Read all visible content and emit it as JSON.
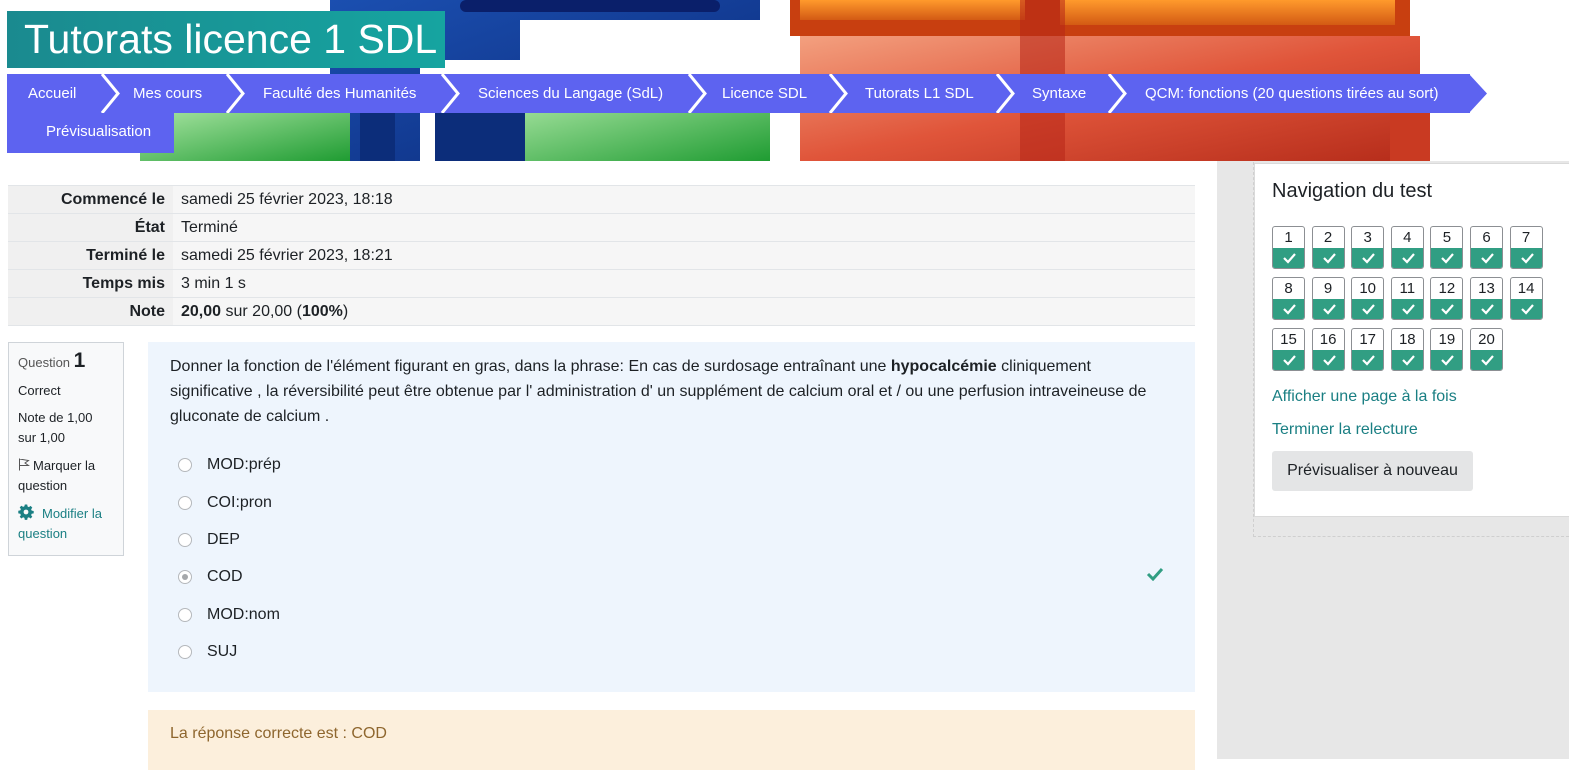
{
  "header": {
    "title": "Tutorats licence 1 SDL"
  },
  "breadcrumb": [
    {
      "label": "Accueil"
    },
    {
      "label": "Mes cours"
    },
    {
      "label": "Faculté des Humanités"
    },
    {
      "label": "Sciences du Langage (SdL)"
    },
    {
      "label": "Licence SDL"
    },
    {
      "label": "Tutorats L1 SDL"
    },
    {
      "label": "Syntaxe"
    },
    {
      "label": "QCM: fonctions (20 questions tirées au sort)"
    },
    {
      "label": "Prévisualisation"
    }
  ],
  "summary": {
    "started_label": "Commencé le",
    "started_value": "samedi 25 février 2023, 18:18",
    "state_label": "État",
    "state_value": "Terminé",
    "completed_label": "Terminé le",
    "completed_value": "samedi 25 février 2023, 18:21",
    "time_label": "Temps mis",
    "time_value": "3 min 1 s",
    "grade_label": "Note",
    "grade_score": "20,00",
    "grade_mid": " sur 20,00 (",
    "grade_percent": "100%",
    "grade_end": ")"
  },
  "question": {
    "label": "Question",
    "number": "1",
    "state": "Correct",
    "grade": "Note de 1,00 sur 1,00",
    "flag_label": "Marquer la question",
    "edit_label": "Modifier la question",
    "text_before": "Donner la fonction de l'élément figurant en gras, dans la phrase: En cas de surdosage entraînant une ",
    "text_bold": "hypocalcémie",
    "text_after": " cliniquement significative , la réversibilité peut être obtenue par l' administration d' un supplément de calcium oral et / ou une perfusion intraveineuse de gluconate de calcium .",
    "answers": [
      {
        "label": "MOD:prép",
        "selected": false
      },
      {
        "label": "COI:pron",
        "selected": false
      },
      {
        "label": "DEP",
        "selected": false
      },
      {
        "label": "COD",
        "selected": true,
        "correct": true
      },
      {
        "label": "MOD:nom",
        "selected": false
      },
      {
        "label": "SUJ",
        "selected": false
      }
    ],
    "right_answer": "La réponse correcte est : COD"
  },
  "quiz_nav": {
    "title": "Navigation du test",
    "questions": [
      "1",
      "2",
      "3",
      "4",
      "5",
      "6",
      "7",
      "8",
      "9",
      "10",
      "11",
      "12",
      "13",
      "14",
      "15",
      "16",
      "17",
      "18",
      "19",
      "20"
    ],
    "all_correct": true,
    "show_one_page_label": "Afficher une page à la fois",
    "finish_review_label": "Terminer la relecture",
    "preview_again_label": "Prévisualiser à nouveau"
  },
  "colors": {
    "breadcrumb_bg": "#5d63f0",
    "title_bg": "#16a4a0",
    "correct_green": "#319e83",
    "link_teal": "#1a7f83",
    "question_bg": "#eef5fd",
    "outcome_bg": "#fcefdc"
  },
  "icons": {
    "check": "check-icon",
    "flag": "flag-icon",
    "gear": "gear-icon"
  }
}
